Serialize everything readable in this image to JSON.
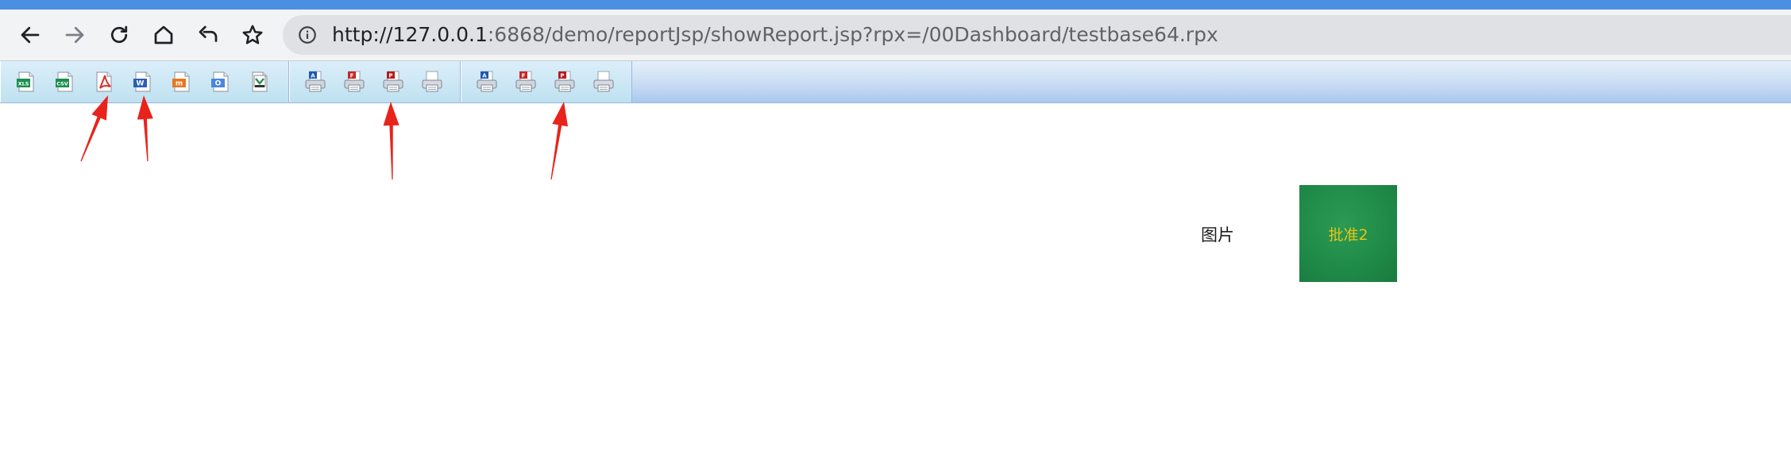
{
  "browser": {
    "url_scheme_host": "http://127.0.0.1",
    "url_rest": ":6868/demo/reportJsp/showReport.jsp?rpx=/00Dashboard/testbase64.rpx",
    "nav_icons": [
      "back-icon",
      "forward-icon",
      "reload-icon",
      "home-icon",
      "undo-icon",
      "bookmark-star-icon"
    ]
  },
  "report_toolbar": {
    "export_group": [
      {
        "name": "export-excel",
        "badge": "XLS",
        "color": "#1e8f4e"
      },
      {
        "name": "export-csv",
        "badge": "CSV",
        "color": "#1e8f4e"
      },
      {
        "name": "export-pdf",
        "badge": "PDF",
        "color": "#d9302c"
      },
      {
        "name": "export-word",
        "badge": "W",
        "color": "#2b5fb8"
      },
      {
        "name": "export-html",
        "badge": "m",
        "color": "#e87722"
      },
      {
        "name": "export-ofd",
        "badge": "O",
        "color": "#4b86e0"
      },
      {
        "name": "export-image",
        "badge": "",
        "color": "#2e8b57"
      }
    ],
    "print_group": [
      {
        "name": "print-applet",
        "badge": "A",
        "color": "#1d58b5"
      },
      {
        "name": "print-flash",
        "badge": "F",
        "color": "#c62828"
      },
      {
        "name": "print-pdf",
        "badge": "P",
        "color": "#b71c1c"
      },
      {
        "name": "print-direct",
        "badge": "",
        "color": "#8a8a8a"
      }
    ],
    "print2_group": [
      {
        "name": "print2-applet",
        "badge": "A",
        "color": "#1d58b5"
      },
      {
        "name": "print2-flash",
        "badge": "F",
        "color": "#c62828"
      },
      {
        "name": "print2-pdf",
        "badge": "P",
        "color": "#b71c1c"
      },
      {
        "name": "print2-direct",
        "badge": "",
        "color": "#5a6fa8"
      }
    ]
  },
  "annotation_color": "#e8231b",
  "content": {
    "image_label": "图片",
    "image_text": "批准2"
  }
}
